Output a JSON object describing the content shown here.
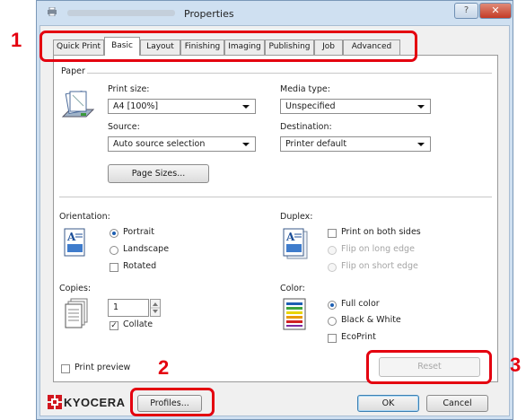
{
  "window": {
    "title": "Properties",
    "help_glyph": "?",
    "close_glyph": "✕"
  },
  "tabs": [
    {
      "label": "Quick Print",
      "active": false
    },
    {
      "label": "Basic",
      "active": true
    },
    {
      "label": "Layout",
      "active": false
    },
    {
      "label": "Finishing",
      "active": false
    },
    {
      "label": "Imaging",
      "active": false
    },
    {
      "label": "Publishing",
      "active": false
    },
    {
      "label": "Job",
      "active": false
    },
    {
      "label": "Advanced",
      "active": false
    }
  ],
  "paper": {
    "group_label": "Paper",
    "print_size_label": "Print size:",
    "print_size_value": "A4  [100%]",
    "media_type_label": "Media type:",
    "media_type_value": "Unspecified",
    "source_label": "Source:",
    "source_value": "Auto source selection",
    "destination_label": "Destination:",
    "destination_value": "Printer default",
    "page_sizes_button": "Page Sizes..."
  },
  "orientation": {
    "label": "Orientation:",
    "portrait": "Portrait",
    "landscape": "Landscape",
    "rotated": "Rotated",
    "selected": "Portrait"
  },
  "duplex": {
    "label": "Duplex:",
    "print_both_sides": "Print on both sides",
    "flip_long": "Flip on long edge",
    "flip_short": "Flip on short edge"
  },
  "copies": {
    "label": "Copies:",
    "value": "1",
    "collate": "Collate",
    "collate_checked": true
  },
  "color": {
    "label": "Color:",
    "full_color": "Full color",
    "black_white": "Black & White",
    "ecoprint": "EcoPrint",
    "selected": "Full color"
  },
  "print_preview": "Print preview",
  "reset_button": "Reset",
  "profiles_button": "Profiles...",
  "ok_button": "OK",
  "cancel_button": "Cancel",
  "logo_text": "KYOCERA",
  "callouts": {
    "one": "1",
    "two": "2",
    "three": "3"
  },
  "colors": {
    "callout_red": "#e4000f",
    "radio_selected": "#1d5fb3",
    "kyocera_red": "#d2161e"
  }
}
